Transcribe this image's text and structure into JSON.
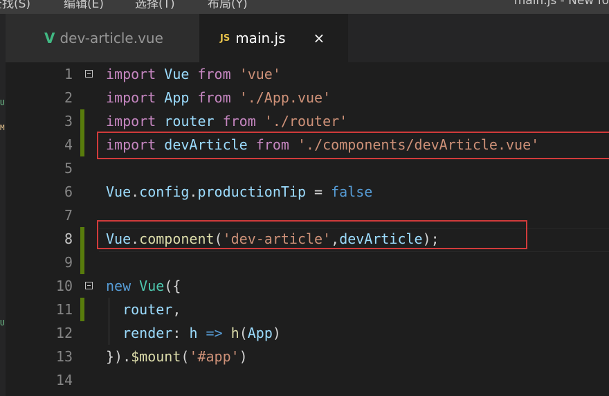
{
  "menubar": {
    "items": [
      "查找(S)",
      "编辑(E)",
      "选择(T)",
      "布局(Y)"
    ],
    "window_title": "main.js - New fo"
  },
  "tabs": [
    {
      "label": "dev-article.vue",
      "icon": "vue-icon",
      "active": false
    },
    {
      "label": "main.js",
      "icon": "js-icon",
      "active": true,
      "close": "×"
    }
  ],
  "editor": {
    "language": "javascript",
    "current_line": 8,
    "lines": [
      {
        "n": "1",
        "tokens": [
          [
            "kw",
            "import"
          ],
          [
            "pun",
            " "
          ],
          [
            "id",
            "Vue"
          ],
          [
            "pun",
            " "
          ],
          [
            "kw",
            "from"
          ],
          [
            "pun",
            " "
          ],
          [
            "str",
            "'vue'"
          ]
        ]
      },
      {
        "n": "2",
        "tokens": [
          [
            "kw",
            "import"
          ],
          [
            "pun",
            " "
          ],
          [
            "id",
            "App"
          ],
          [
            "pun",
            " "
          ],
          [
            "kw",
            "from"
          ],
          [
            "pun",
            " "
          ],
          [
            "str",
            "'./App.vue'"
          ]
        ]
      },
      {
        "n": "3",
        "tokens": [
          [
            "kw",
            "import"
          ],
          [
            "pun",
            " "
          ],
          [
            "id",
            "router"
          ],
          [
            "pun",
            " "
          ],
          [
            "kw",
            "from"
          ],
          [
            "pun",
            " "
          ],
          [
            "str",
            "'./router'"
          ]
        ]
      },
      {
        "n": "4",
        "tokens": [
          [
            "kw",
            "import"
          ],
          [
            "pun",
            " "
          ],
          [
            "id",
            "devArticle"
          ],
          [
            "pun",
            " "
          ],
          [
            "kw",
            "from"
          ],
          [
            "pun",
            " "
          ],
          [
            "str",
            "'./components/devArticle.vue'"
          ]
        ]
      },
      {
        "n": "5",
        "tokens": []
      },
      {
        "n": "6",
        "tokens": [
          [
            "id",
            "Vue"
          ],
          [
            "pun",
            "."
          ],
          [
            "id",
            "config"
          ],
          [
            "pun",
            "."
          ],
          [
            "id",
            "productionTip"
          ],
          [
            "op",
            " = "
          ],
          [
            "kw2",
            "false"
          ]
        ]
      },
      {
        "n": "7",
        "tokens": []
      },
      {
        "n": "8",
        "tokens": [
          [
            "id",
            "Vue"
          ],
          [
            "pun",
            "."
          ],
          [
            "fn",
            "component"
          ],
          [
            "pun",
            "("
          ],
          [
            "str",
            "'dev-article'"
          ],
          [
            "pun",
            ","
          ],
          [
            "id",
            "devArticle"
          ],
          [
            "pun",
            ");"
          ]
        ]
      },
      {
        "n": "9",
        "tokens": []
      },
      {
        "n": "10",
        "tokens": [
          [
            "kw2",
            "new"
          ],
          [
            "pun",
            " "
          ],
          [
            "cls",
            "Vue"
          ],
          [
            "pun",
            "({"
          ]
        ]
      },
      {
        "n": "11",
        "tokens": [
          [
            "pun",
            "  "
          ],
          [
            "id",
            "router"
          ],
          [
            "pun",
            ","
          ]
        ]
      },
      {
        "n": "12",
        "tokens": [
          [
            "pun",
            "  "
          ],
          [
            "id",
            "render"
          ],
          [
            "pun",
            ": "
          ],
          [
            "id",
            "h"
          ],
          [
            "pun",
            " "
          ],
          [
            "kw2",
            "=>"
          ],
          [
            "pun",
            " "
          ],
          [
            "fn",
            "h"
          ],
          [
            "pun",
            "("
          ],
          [
            "id",
            "App"
          ],
          [
            "pun",
            ")"
          ]
        ]
      },
      {
        "n": "13",
        "tokens": [
          [
            "pun",
            "})."
          ],
          [
            "fn",
            "$mount"
          ],
          [
            "pun",
            "("
          ],
          [
            "str",
            "'#app'"
          ],
          [
            "pun",
            ")"
          ]
        ]
      },
      {
        "n": "14",
        "tokens": []
      }
    ]
  },
  "colors": {
    "background": "#1e1e1e",
    "keyword": "#c586c0",
    "keyword_blue": "#569cd6",
    "identifier": "#9cdcfe",
    "string": "#ce9178",
    "function": "#dcdcaa",
    "class": "#4ec9b0",
    "gutter_modified": "#587c0c",
    "highlight_box": "#d13b3b"
  }
}
